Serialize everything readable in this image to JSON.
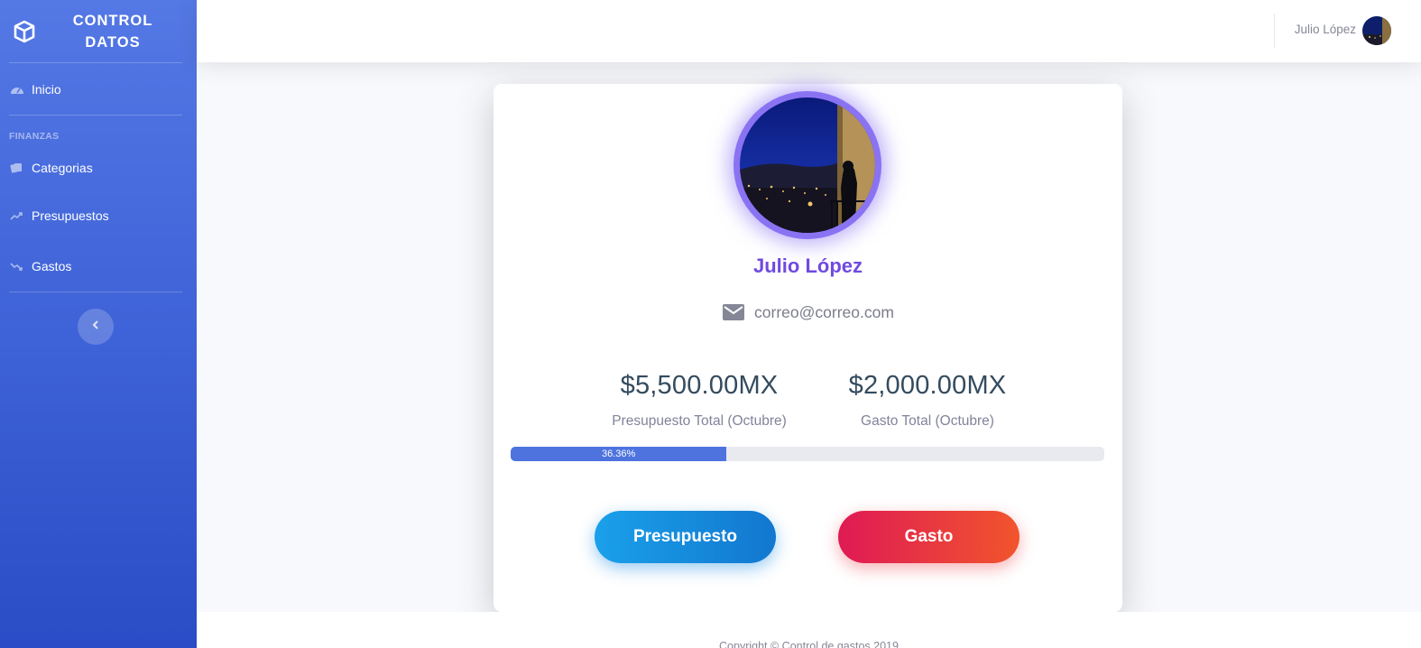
{
  "sidebar": {
    "brand_line1": "CONTROL",
    "brand_line2": "DATOS",
    "brand_icon": "cube-icon",
    "items": [
      {
        "label": "Inicio",
        "icon": "dashboard-gauge-icon"
      },
      {
        "label": "Categorias",
        "icon": "cards-icon"
      },
      {
        "label": "Presupuestos",
        "icon": "trend-up-icon"
      },
      {
        "label": "Gastos",
        "icon": "trend-down-icon"
      }
    ],
    "section_heading": "FINANZAS",
    "toggle_icon": "chevron-left-icon"
  },
  "topbar": {
    "user_name": "Julio López"
  },
  "profile": {
    "name": "Julio López",
    "email": "correo@correo.com",
    "email_icon": "mail-icon",
    "budget_value": "$5,500.00MX",
    "budget_label": "Presupuesto Total (Octubre)",
    "expense_value": "$2,000.00MX",
    "expense_label": "Gasto Total (Octubre)",
    "progress_percent": 36.36,
    "progress_label": "36.36%",
    "button_budget": "Presupuesto",
    "button_expense": "Gasto"
  },
  "footer": {
    "text": "Copyright © Control de gastos 2019"
  },
  "colors": {
    "sidebar_top": "#5478e4",
    "sidebar_bottom": "#2a4cc5",
    "accent_purple": "#6f4ae0",
    "progress": "#4e73df",
    "button_blue": "#1a8ce6",
    "button_red": "#e8353f"
  }
}
